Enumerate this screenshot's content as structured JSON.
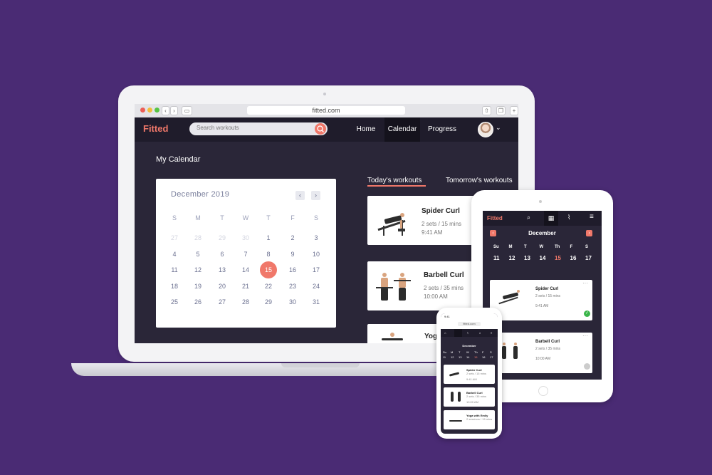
{
  "browser": {
    "url": "fitted.com"
  },
  "app": {
    "logo": "Fitted",
    "search_placeholder": "Search workouts",
    "nav": {
      "home": "Home",
      "calendar": "Calendar",
      "progress": "Progress"
    }
  },
  "page": {
    "title": "My Calendar"
  },
  "calendar": {
    "month": "December 2019",
    "weekdays": [
      "S",
      "M",
      "T",
      "W",
      "T",
      "F",
      "S"
    ],
    "weeks": [
      [
        "27",
        "28",
        "29",
        "30",
        "1",
        "2",
        "3"
      ],
      [
        "4",
        "5",
        "6",
        "7",
        "8",
        "9",
        "10"
      ],
      [
        "11",
        "12",
        "13",
        "14",
        "15",
        "16",
        "17"
      ],
      [
        "18",
        "19",
        "20",
        "21",
        "22",
        "23",
        "24"
      ],
      [
        "25",
        "26",
        "27",
        "28",
        "29",
        "30",
        "31"
      ]
    ],
    "selected": "15"
  },
  "tabs": {
    "today": "Today's workouts",
    "tomorrow": "Tomorrow's workouts"
  },
  "workouts": [
    {
      "name": "Spider Curl",
      "meta": "2 sets / 15 mins",
      "time": "9:41 AM"
    },
    {
      "name": "Barbell Curl",
      "meta": "2 sets / 35 mins",
      "time": "10:00 AM"
    },
    {
      "name": "Yoga with Emily"
    }
  ],
  "tablet": {
    "logo": "Fitted",
    "month": "December",
    "weekdays": [
      "Su",
      "M",
      "T",
      "W",
      "Th",
      "F",
      "S"
    ],
    "days": [
      "11",
      "12",
      "13",
      "14",
      "15",
      "16",
      "17"
    ],
    "selected": "15",
    "cards": [
      {
        "name": "Spider Curl",
        "meta": "2 sets / 15 mins",
        "time": "9:41 AM",
        "done": true
      },
      {
        "name": "Barbell Curl",
        "meta": "2 sets / 35 mins",
        "time": "10:00 AM",
        "done": false
      }
    ]
  },
  "phone": {
    "status_time": "9:41",
    "url": "fitted.com",
    "month": "December",
    "weekdays": [
      "Su",
      "M",
      "T",
      "W",
      "Th",
      "F",
      "S"
    ],
    "days": [
      "11",
      "12",
      "13",
      "14",
      "15",
      "16",
      "17"
    ],
    "cards": [
      {
        "name": "Spider Curl",
        "meta": "2 sets / 15 mins",
        "time": "9:41 AM"
      },
      {
        "name": "Barbell Curl",
        "meta": "2 sets / 35 mins",
        "time": "10:00 AM"
      },
      {
        "name": "Yoga with Emily",
        "meta": "2 sessions / 15 mins"
      }
    ]
  },
  "colors": {
    "accent": "#f0786a",
    "background": "#4a2b74",
    "app_dark": "#2a2638",
    "header_dark": "#1f1c2b"
  }
}
